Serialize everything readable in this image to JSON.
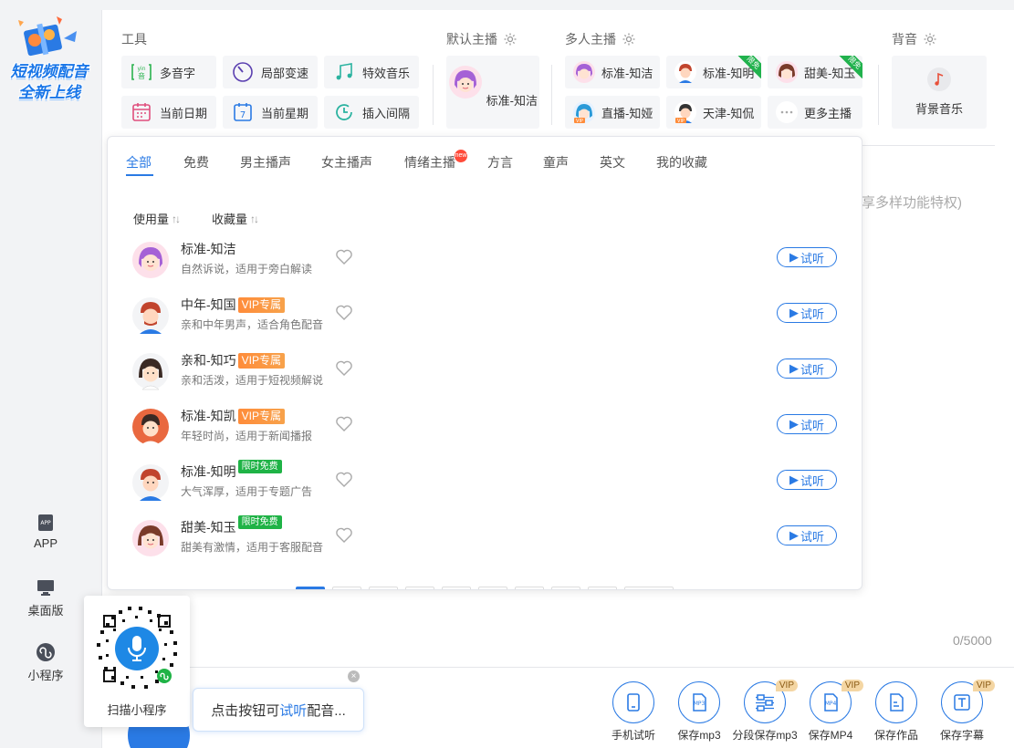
{
  "promo": {
    "line1": "短视频配音",
    "line2": "全新上线"
  },
  "sidebar": {
    "items": [
      {
        "label": "APP",
        "icon": "app-icon"
      },
      {
        "label": "桌面版",
        "icon": "desktop-icon"
      },
      {
        "label": "小程序",
        "icon": "mini-program-icon"
      }
    ]
  },
  "tools": {
    "title": "工具",
    "buttons": [
      {
        "label": "多音字",
        "icon": "pinyin-icon"
      },
      {
        "label": "局部变速",
        "icon": "speed-dial-icon"
      },
      {
        "label": "特效音乐",
        "icon": "music-notes-icon"
      },
      {
        "label": "当前日期",
        "icon": "calendar-icon"
      },
      {
        "label": "当前星期",
        "icon": "weekday-calendar-icon"
      },
      {
        "label": "插入间隔",
        "icon": "clock-interval-icon"
      }
    ]
  },
  "default_anchor": {
    "title": "默认主播",
    "name": "标准-知洁"
  },
  "multi_anchor": {
    "title": "多人主播",
    "buttons": [
      {
        "label": "标准-知洁",
        "free": false
      },
      {
        "label": "标准-知明",
        "free": true
      },
      {
        "label": "甜美-知玉",
        "free": true
      },
      {
        "label": "直播-知娅",
        "vip": "VIP"
      },
      {
        "label": "天津-知侃",
        "vip": "VIP"
      },
      {
        "label": "更多主播"
      }
    ],
    "ribbon_text": "限免"
  },
  "background": {
    "title": "背音",
    "label": "背景音乐"
  },
  "panel": {
    "tabs": [
      "全部",
      "免费",
      "男主播声",
      "女主播声",
      "情绪主播",
      "方言",
      "童声",
      "英文",
      "我的收藏"
    ],
    "active_tab": "全部",
    "hot_badge": "new",
    "sort": [
      {
        "label": "使用量",
        "arrow": "↑↓"
      },
      {
        "label": "收藏量",
        "arrow": "↑↓"
      }
    ],
    "listen_label": "试听",
    "voices": [
      {
        "name": "标准-知洁",
        "badge": "",
        "badge_type": "",
        "desc": "自然诉说，适用于旁白解读"
      },
      {
        "name": "中年-知国",
        "badge": "VIP专属",
        "badge_type": "vip",
        "desc": "亲和中年男声，适合角色配音"
      },
      {
        "name": "亲和-知巧",
        "badge": "VIP专属",
        "badge_type": "vip",
        "desc": "亲和活泼，适用于短视频解说"
      },
      {
        "name": "标准-知凯",
        "badge": "VIP专属",
        "badge_type": "vip",
        "desc": "年轻时尚，适用于新闻播报"
      },
      {
        "name": "标准-知明",
        "badge": "限时免费",
        "badge_type": "free",
        "desc": "大气浑厚，适用于专题广告"
      },
      {
        "name": "甜美-知玉",
        "badge": "限时免费",
        "badge_type": "free",
        "desc": "甜美有激情，适用于客服配音"
      }
    ]
  },
  "editor": {
    "hint_bg": "享多样功能特权)",
    "counter": "0/5000"
  },
  "qr": {
    "caption": "扫描小程序"
  },
  "tip": {
    "prefix": "点击按钮可",
    "highlight": "试听",
    "suffix": "配音..."
  },
  "actions": [
    {
      "label": "手机试听",
      "vip": ""
    },
    {
      "label": "保存mp3",
      "vip": ""
    },
    {
      "label": "分段保存mp3",
      "vip": "VIP"
    },
    {
      "label": "保存MP4",
      "vip": "VIP"
    },
    {
      "label": "保存作品",
      "vip": ""
    },
    {
      "label": "保存字幕",
      "vip": "VIP"
    }
  ],
  "colors": {
    "accent": "#2a7ae4",
    "vip": "#ff8c3a",
    "free": "#1fb346"
  }
}
